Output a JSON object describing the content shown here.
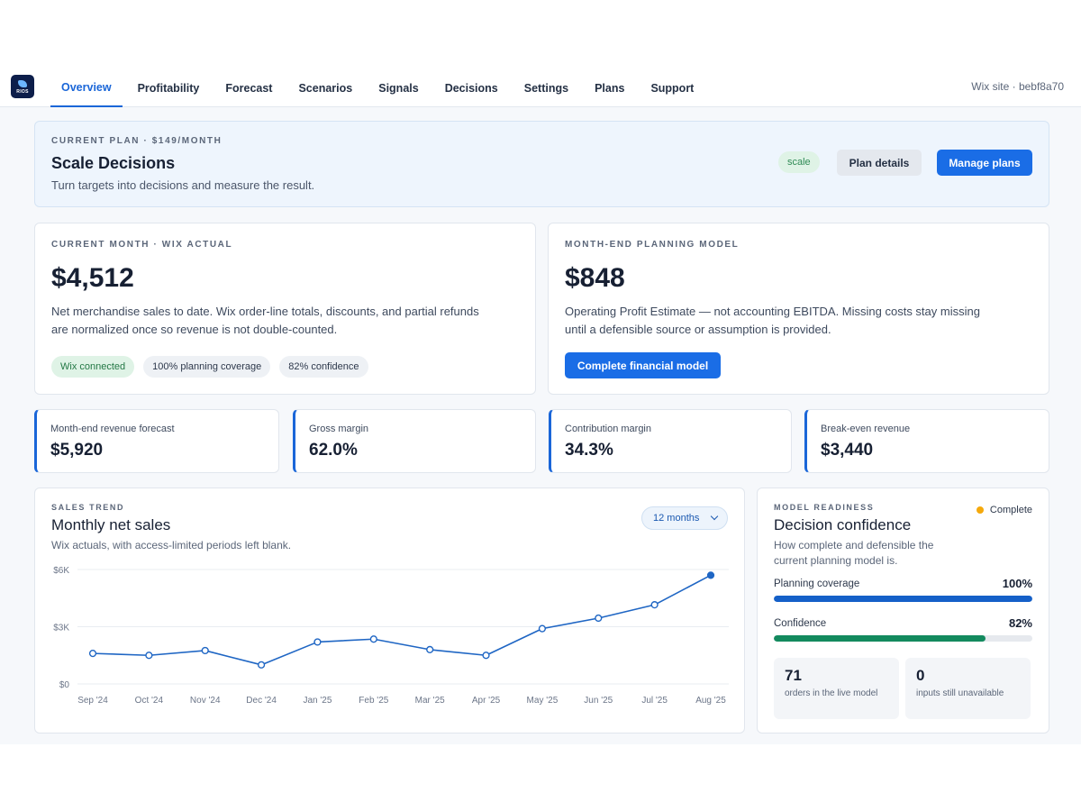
{
  "nav": {
    "logo_text": "RIOS",
    "items": [
      {
        "label": "Overview"
      },
      {
        "label": "Profitability"
      },
      {
        "label": "Forecast"
      },
      {
        "label": "Scenarios"
      },
      {
        "label": "Signals"
      },
      {
        "label": "Decisions"
      },
      {
        "label": "Settings"
      },
      {
        "label": "Plans"
      },
      {
        "label": "Support"
      }
    ],
    "site_label": "Wix site · bebf8a70"
  },
  "plan": {
    "eyebrow": "CURRENT PLAN · $149/month",
    "title": "Scale Decisions",
    "subtitle": "Turn targets into decisions and measure the result.",
    "badge": "scale",
    "details_button": "Plan details",
    "manage_button": "Manage plans"
  },
  "actual_card": {
    "eyebrow": "CURRENT MONTH · WIX ACTUAL",
    "value": "$4,512",
    "description": "Net merchandise sales to date. Wix order-line totals, discounts, and partial refunds are normalized once so revenue is not double-counted.",
    "chips": [
      "Wix connected",
      "100% planning coverage",
      "82% confidence"
    ]
  },
  "model_card": {
    "eyebrow": "MONTH-END PLANNING MODEL",
    "value": "$848",
    "description": "Operating Profit Estimate — not accounting EBITDA. Missing costs stay missing until a defensible source or assumption is provided.",
    "button": "Complete financial model"
  },
  "kpis": [
    {
      "label": "Month-end revenue forecast",
      "value": "$5,920"
    },
    {
      "label": "Gross margin",
      "value": "62.0%"
    },
    {
      "label": "Contribution margin",
      "value": "34.3%"
    },
    {
      "label": "Break-even revenue",
      "value": "$3,440"
    }
  ],
  "trend": {
    "eyebrow": "SALES TREND",
    "title": "Monthly net sales",
    "subtitle": "Wix actuals, with access-limited periods left blank.",
    "range": "12 months"
  },
  "chart_data": {
    "type": "line",
    "title": "Monthly net sales",
    "categories": [
      "Sep '24",
      "Oct '24",
      "Nov '24",
      "Dec '24",
      "Jan '25",
      "Feb '25",
      "Mar '25",
      "Apr '25",
      "May '25",
      "Jun '25",
      "Jul '25",
      "Aug '25"
    ],
    "values": [
      1600,
      1500,
      1750,
      1000,
      2200,
      2350,
      1800,
      1500,
      2900,
      3450,
      4150,
      5700
    ],
    "ylim": [
      0,
      6000
    ],
    "yticks": [
      {
        "value": 0,
        "label": "$0"
      },
      {
        "value": 3000,
        "label": "$3K"
      },
      {
        "value": 6000,
        "label": "$6K"
      }
    ],
    "grid": true,
    "line_color": "#1f66c4"
  },
  "readiness": {
    "eyebrow": "MODEL READINESS",
    "title": "Decision confidence",
    "subtitle": "How complete and defensible the current planning model is.",
    "status": "Complete",
    "metrics": [
      {
        "label": "Planning coverage",
        "value_text": "100%",
        "fraction": 1.0,
        "color": "#1560c8"
      },
      {
        "label": "Confidence",
        "value_text": "82%",
        "fraction": 0.82,
        "color": "#138a5e"
      }
    ],
    "stats": [
      {
        "number": "71",
        "text": "orders in the live model"
      },
      {
        "number": "0",
        "text": "inputs still unavailable"
      }
    ]
  }
}
